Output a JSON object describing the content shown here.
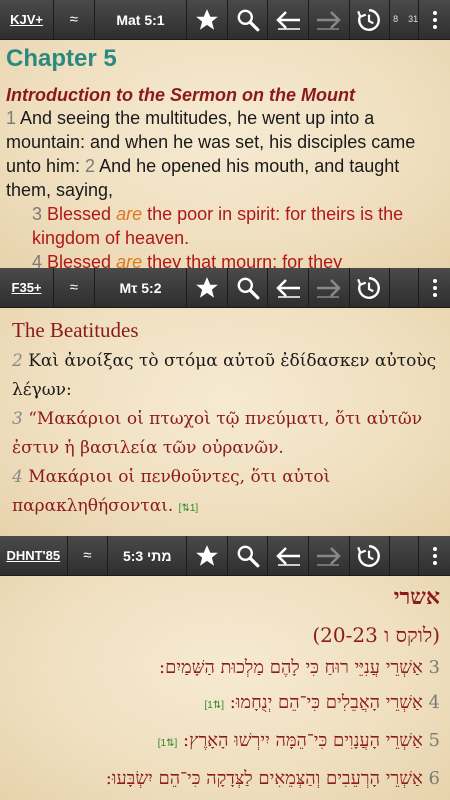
{
  "toolbar1": {
    "version": "KJV+",
    "sync": "≈",
    "reference": "Mat 5:1",
    "count_top": "8",
    "count_bottom": "31"
  },
  "toolbar2": {
    "version": "F35+",
    "sync": "≈",
    "reference": "Μτ 5:2"
  },
  "toolbar3": {
    "version": "DHNT'85",
    "sync": "≈",
    "reference": "מתי 5:3"
  },
  "pane1": {
    "chapter": "Chapter 5",
    "heading": "Introduction to the Sermon on the Mount",
    "v1_num": "1",
    "v1_text": " And seeing the multitudes, he went up into a mountain: and when he was set, his disciples came unto him: ",
    "v2_num": "2",
    "v2_text": " And he opened his mouth, and taught them, saying,",
    "v3_num": "3",
    "v3_a": " Blessed ",
    "v3_are": "are",
    "v3_b": " the poor in spirit: for theirs is the kingdom of heaven.",
    "v4_num": "4",
    "v4_a": " Blessed ",
    "v4_are": "are",
    "v4_b": " they that mourn: for they"
  },
  "pane2": {
    "heading": "The Beatitudes",
    "v2_num": "2",
    "v2_text": " Καὶ ἀνοίξας τὸ στόμα αὐτοῦ ἐδίδασκεν αὐτοὺς λέγων:",
    "v3_num": "3",
    "v3_text": " “Μακάριοι οἱ πτωχοὶ τῷ πνεύματι, ὅτι αὐτῶν ἐστιν ἡ βασιλεία τῶν οὐρανῶν.",
    "v4_num": "4",
    "v4_text": " Μακάριοι οἱ πενθοῦντες, ὅτι αὐτοὶ παρακληθήσονται.",
    "v4_xref": "[⇅1]"
  },
  "pane3": {
    "heading": "אשרי",
    "sub": "(לוקס ו 20-23)",
    "v3_num": "3",
    "v3_text": "אַשְׁרֵי עֲנִיֵּי רוּחַ כִּי לָהֶם מַלְכוּת הַשָּׁמַיִם:",
    "v4_num": "4",
    "v4_text": "אַשְׁרֵי הָאֲבֵלִים כִּי־הֵם יְנֻחָמוּ:",
    "v4_xref": "[⇅1]",
    "v5_num": "5",
    "v5_text": "אַשְׁרֵי הָעֲנָוִים כִּי־הֵמָּה יִירְשׁוּ הָאָרֶץ:",
    "v5_xref": "[⇅1]",
    "v6_num": "6",
    "v6_text": "אַשְׁרֵי הָרְעֵבִים וְהַצְּמֵאִים לַצְּדָקָה כִּי־הֵם יִשְׂבָּעוּ:"
  },
  "icons": [
    "star-icon",
    "search-icon",
    "back-arrow-icon",
    "forward-arrow-icon",
    "history-icon",
    "overflow-menu-icon"
  ]
}
